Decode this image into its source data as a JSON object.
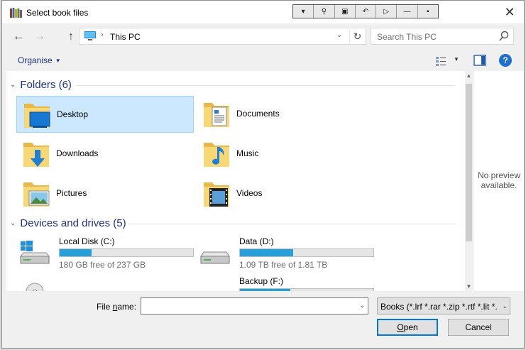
{
  "window": {
    "title": "Select book files",
    "close_glyph": "✕"
  },
  "float_toolbar": {
    "buttons": [
      "▾",
      "⚲",
      "▣",
      "↶",
      "▷",
      "—",
      "▪"
    ]
  },
  "navigation": {
    "back_glyph": "←",
    "forward_glyph": "→",
    "up_glyph": "↑",
    "breadcrumb_separator": "›",
    "location": "This PC",
    "dropdown_glyph": "⌄",
    "refresh_glyph": "↻"
  },
  "search": {
    "placeholder": "Search This PC",
    "icon": "search-icon"
  },
  "commandbar": {
    "organise_label": "Organise",
    "organise_caret": "▼",
    "view_caret": "▼",
    "help_glyph": "?"
  },
  "groups": {
    "folders_header": "Folders (6)",
    "devices_header": "Devices and drives (5)",
    "chevron": "⌄"
  },
  "folders": [
    {
      "label": "Desktop",
      "icon": "desktop-folder-icon",
      "selected": true
    },
    {
      "label": "Documents",
      "icon": "documents-folder-icon"
    },
    {
      "label": "Downloads",
      "icon": "downloads-folder-icon"
    },
    {
      "label": "Music",
      "icon": "music-folder-icon"
    },
    {
      "label": "Pictures",
      "icon": "pictures-folder-icon"
    },
    {
      "label": "Videos",
      "icon": "videos-folder-icon"
    }
  ],
  "drives": [
    {
      "name": "Local Disk (C:)",
      "free": "180 GB free of 237 GB",
      "used_fraction": 0.24,
      "icon": "windows-drive-icon"
    },
    {
      "name": "Data (D:)",
      "free": "1.09 TB free of 1.81 TB",
      "used_fraction": 0.4,
      "icon": "hard-drive-icon"
    },
    {
      "name": "Backup (F:)",
      "used_fraction": 0.38,
      "icon": "hard-drive-icon"
    }
  ],
  "preview": {
    "line1": "No preview",
    "line2": "available."
  },
  "scrollbar": {
    "up_glyph": "▲",
    "down_glyph": "▼"
  },
  "footer": {
    "filename_label_prefix": "File ",
    "filename_label_accel": "n",
    "filename_label_suffix": "ame:",
    "filename_value": "",
    "filename_dropdown_glyph": "⌄",
    "filter_value": "Books (*.lrf *.rar *.zip *.rtf *.lit *.",
    "filter_dropdown_glyph": "⌄",
    "open_accel": "O",
    "open_rest": "pen",
    "cancel_label": "Cancel"
  },
  "colors": {
    "accent": "#0078d7",
    "selection_bg": "#cce8ff",
    "drive_bar": "#26a0da",
    "header_text": "#1e3287",
    "folder_yellow": "#f8d775"
  }
}
